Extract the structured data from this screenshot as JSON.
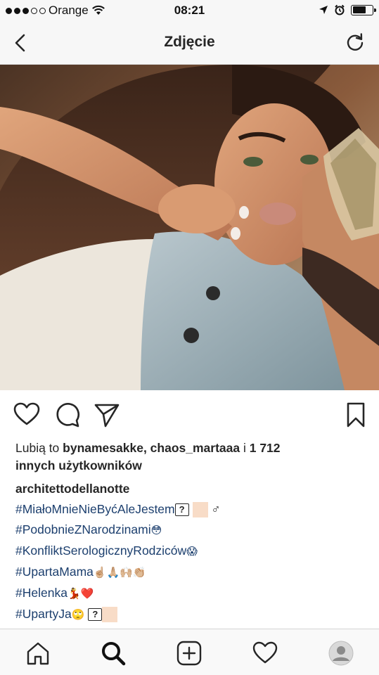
{
  "status_bar": {
    "carrier": "Orange",
    "time": "08:21"
  },
  "nav": {
    "title": "Zdjęcie"
  },
  "post": {
    "likes_prefix": "Lubią to ",
    "likes_users": "bynamesakke, chaos_martaaa",
    "likes_middle": " i ",
    "likes_count": "1 712",
    "likes_suffix": "innych użytkowników",
    "author": "architettodellanotte",
    "hashtags": {
      "h1": "#MiałoMnieNieByćAleJestem",
      "h2": "#PodobnieZNarodzinami",
      "h3": "#KonfliktSerologicznyRodziców",
      "h4": "#UpartaMama",
      "h5": "#Helenka",
      "h6": "#UpartyJa"
    },
    "emoji": {
      "male_sign": "♂",
      "flushed": "😳",
      "scream": "😱",
      "hands": "☝🏼🙏🏼🙌🏼👏🏼",
      "dancer_heart": "💃❤️",
      "rolling_eyes": "🙄",
      "question_box": "?"
    }
  },
  "icons": {
    "back": "chevron-left-icon",
    "refresh": "refresh-icon",
    "like": "heart-icon",
    "comment": "comment-icon",
    "share": "send-icon",
    "save": "bookmark-icon",
    "home": "home-icon",
    "search": "search-icon",
    "add": "add-post-icon",
    "activity": "heart-icon",
    "profile": "avatar"
  },
  "colors": {
    "hashtag": "#1c3f6e",
    "bar_bg": "#f7f7f7"
  }
}
